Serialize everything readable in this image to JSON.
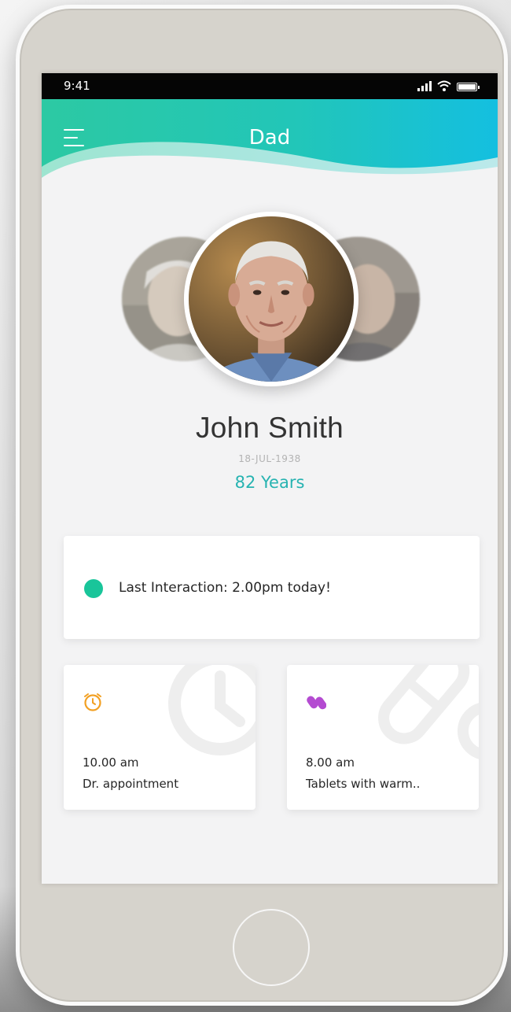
{
  "status_bar": {
    "time": "9:41"
  },
  "header": {
    "title": "Dad"
  },
  "profile": {
    "name": "John Smith",
    "dob": "18-JUL-1938",
    "age": "82 Years"
  },
  "interaction": {
    "text": "Last Interaction: 2.00pm today!"
  },
  "reminders": [
    {
      "icon": "clock-icon",
      "time": "10.00 am",
      "description": "Dr. appointment"
    },
    {
      "icon": "pill-icon",
      "time": "8.00 am",
      "description": "Tablets with warm.."
    }
  ],
  "colors": {
    "header_gradient_start": "#2cc9a3",
    "header_gradient_end": "#17c0dc",
    "accent_teal": "#26b3b1",
    "status_dot": "#19c59a",
    "clock_icon": "#f2a023",
    "pill_icon": "#b44bd1"
  }
}
